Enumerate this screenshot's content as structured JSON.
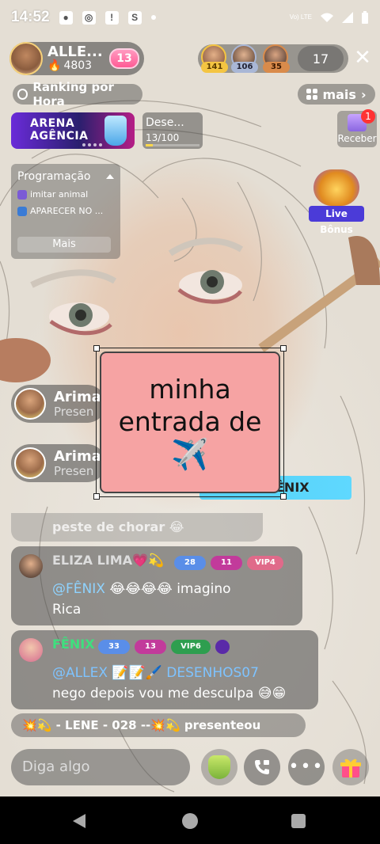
{
  "status_bar": {
    "time": "14:52",
    "network": "Vo) LTE"
  },
  "host": {
    "name": "ALLE...",
    "score": "4803",
    "level_badge": "13"
  },
  "top_viewers": [
    {
      "count": "141",
      "ring": "#f4c542"
    },
    {
      "count": "106",
      "ring": "#a9b7d6"
    },
    {
      "count": "35",
      "ring": "#d98b4b"
    }
  ],
  "viewer_count": "17",
  "ranking_label": "Ranking por Hora",
  "more_label": "mais",
  "arena": {
    "line1": "ARENA",
    "line2": "AGÊNCIA"
  },
  "challenge": {
    "label": "Dese...",
    "progress": "13/100",
    "progress_fraction": 0.13
  },
  "receive": {
    "label": "Receber",
    "badge": "1"
  },
  "schedule": {
    "title": "Programação",
    "items": [
      "imitar animal",
      "APARECER NO ..."
    ],
    "more": "Mais"
  },
  "live_bonus": "Live Bônus",
  "joins": [
    {
      "name": "Arima",
      "sub": "Presen"
    },
    {
      "name": "Arima",
      "sub": "Presen"
    }
  ],
  "entry_banner": "ÊNIX",
  "prev_message": "peste de chorar 😂",
  "messages": [
    {
      "user": "ELIZA LIMA💗💫",
      "badges": [
        "28",
        "11",
        "VIP4"
      ],
      "mention": "@FÊNIX",
      "emoji": "😂😂😂😂",
      "text1": "imagino",
      "text2": "Rica"
    },
    {
      "user": "FÊNIX",
      "badges": [
        "33",
        "13",
        "VIP6"
      ],
      "mention": "@ALLEX 📝📝🖌️ DESENHOS07",
      "text2": "nego depois vou me desculpa 😅😁"
    }
  ],
  "present_line": "💥💫 - LENE - 028 --💥💫 presenteou",
  "input_placeholder": "Diga algo",
  "sticker": {
    "line1": "minha",
    "line2": "entrada de",
    "emoji": "✈️"
  },
  "icons": {
    "call": "video-call-icon",
    "more": "more-dots-icon",
    "gift": "gift-icon"
  }
}
